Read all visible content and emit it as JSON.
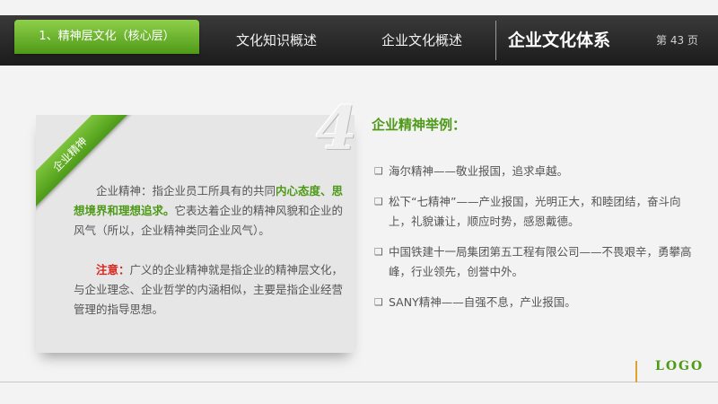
{
  "nav": {
    "active_tab": "1、精神层文化（核心层）",
    "tab2": "文化知识概述",
    "tab3": "企业文化概述",
    "current_title": "企业文化体系",
    "page_number": "第 43 页"
  },
  "card": {
    "big_number": "4",
    "ribbon_label": "企业精神",
    "p1_prefix": "企业精神：指企业员工所具有的共同",
    "p1_highlight": "内心态度、思想境界和理想追求。",
    "p1_suffix": "它表达着企业的精神风貌和企业的风气（所以，企业精神类同企业风气）。",
    "p2_label": "注意：",
    "p2_text": "广义的企业精神就是指企业的精神层文化，与企业理念、企业哲学的内涵相似，主要是指企业经营管理的指导思想。"
  },
  "examples": {
    "title": "企业精神举例：",
    "items": [
      "海尔精神——敬业报国，追求卓越。",
      "松下“七精神”——产业报国，光明正大，和睦团结，奋斗向上，礼貌谦让，顺应时势，感恩戴德。",
      "中国铁建十一局集团第五工程有限公司——不畏艰辛，勇攀高峰，行业领先，创誉中外。",
      "SANY精神——自强不息，产业报国。"
    ],
    "bullet_icon": "square-bullet-icon"
  },
  "footer": {
    "logo": "LOGO"
  },
  "colors": {
    "accent_green": "#4e9a18",
    "highlight_red": "#d7261f",
    "topbar_dark": "#1b1b1b"
  }
}
